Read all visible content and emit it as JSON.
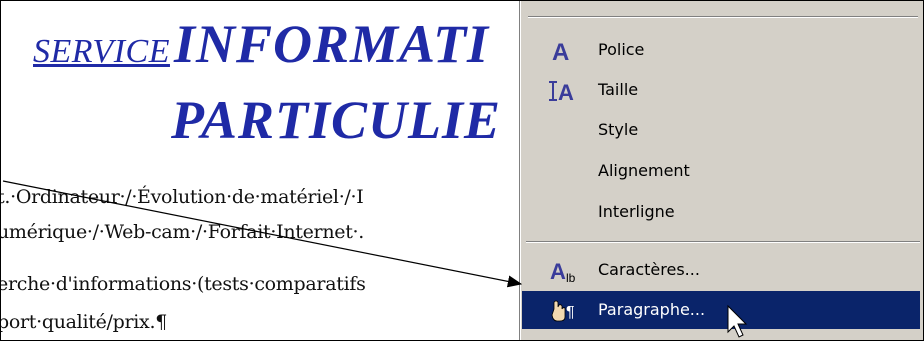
{
  "document": {
    "title_small": "SERVICE",
    "title_big1": "INFORMATI",
    "title_big2": "PARTICULIE",
    "lines": [
      "t.·Ordinateur·/·Évolution·de·matériel·/·I",
      "umérique·/·Web-cam·/·Forfait·Internet·.",
      "erche·d'informations·(tests·comparatifs",
      "port·qualité/prix.¶"
    ]
  },
  "context_menu": {
    "items": [
      {
        "label": "Police",
        "icon": "font-A-icon"
      },
      {
        "label": "Taille",
        "icon": "font-size-icon"
      },
      {
        "label": "Style",
        "icon": ""
      },
      {
        "label": "Alignement",
        "icon": ""
      },
      {
        "label": "Interligne",
        "icon": ""
      },
      {
        "label": "Caractères...",
        "icon": "characters-icon"
      },
      {
        "label": "Paragraphe...",
        "icon": "paragraph-icon"
      }
    ],
    "highlight_color": "#0a246a",
    "background": "#d4d0c8"
  },
  "colors": {
    "title": "#1f2aa6"
  }
}
